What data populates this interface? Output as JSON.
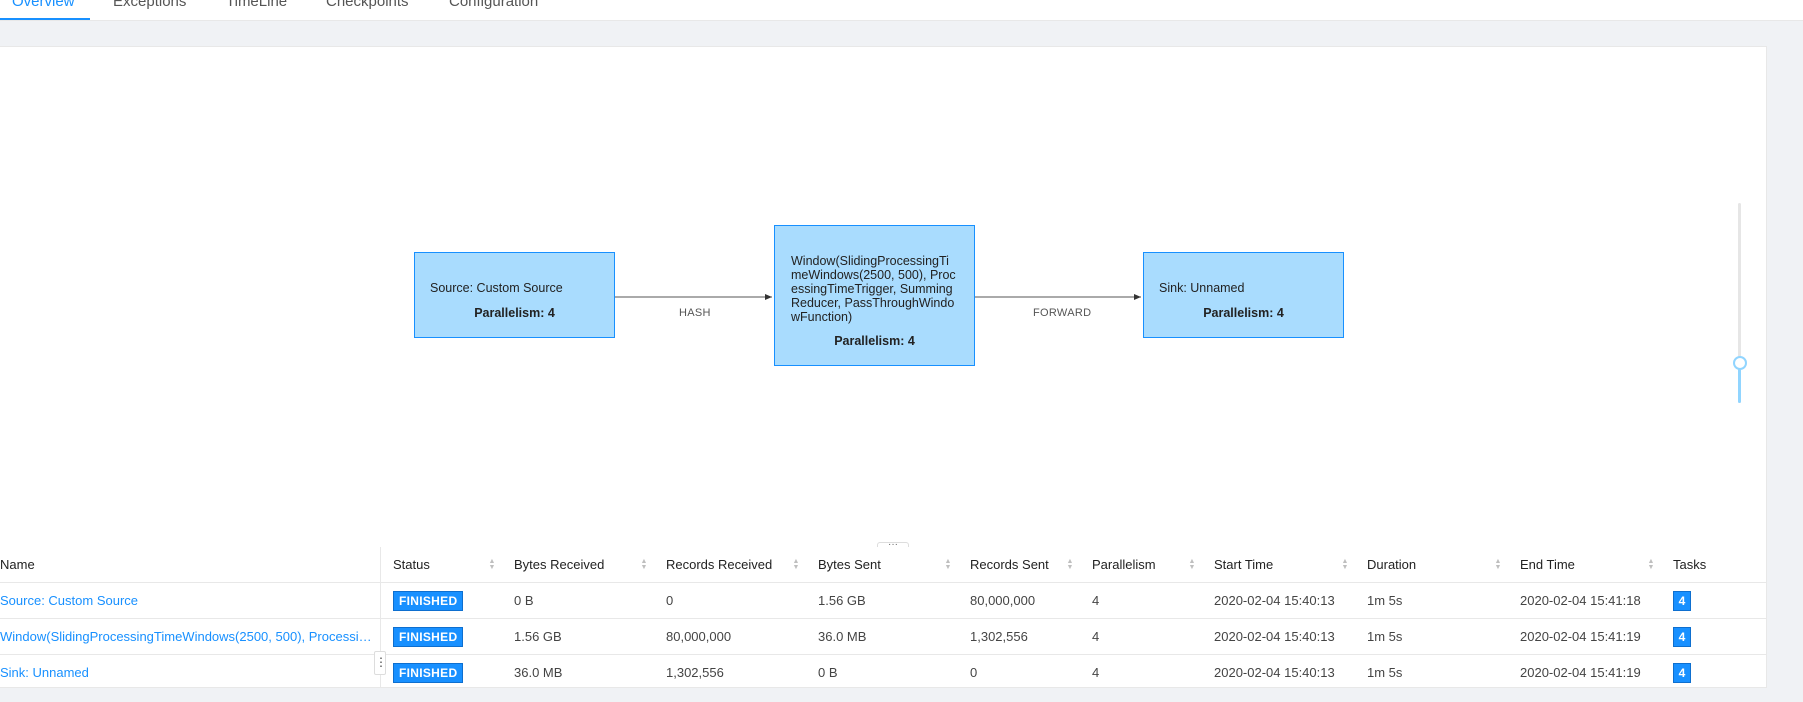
{
  "tabs": [
    {
      "label": "Overview",
      "active": true
    },
    {
      "label": "Exceptions",
      "active": false
    },
    {
      "label": "TimeLine",
      "active": false
    },
    {
      "label": "Checkpoints",
      "active": false
    },
    {
      "label": "Configuration",
      "active": false
    }
  ],
  "graph": {
    "nodes": [
      {
        "name": "Source: Custom Source",
        "parallelism": "Parallelism: 4"
      },
      {
        "name": "Window(SlidingProcessingTimeWindows(2500, 500), ProcessingTimeTrigger, SummingReducer, PassThroughWindowFunction)",
        "parallelism": "Parallelism: 4"
      },
      {
        "name": "Sink: Unnamed",
        "parallelism": "Parallelism: 4"
      }
    ],
    "edges": [
      {
        "label": "HASH"
      },
      {
        "label": "FORWARD"
      }
    ],
    "zoom_level": 0.2
  },
  "table": {
    "columns": [
      "Name",
      "Status",
      "Bytes Received",
      "Records Received",
      "Bytes Sent",
      "Records Sent",
      "Parallelism",
      "Start Time",
      "Duration",
      "End Time",
      "Tasks"
    ],
    "rows": [
      {
        "name": "Source: Custom Source",
        "status": "FINISHED",
        "bytes_received": "0 B",
        "records_received": "0",
        "bytes_sent": "1.56 GB",
        "records_sent": "80,000,000",
        "parallelism": "4",
        "start_time": "2020-02-04 15:40:13",
        "duration": "1m 5s",
        "end_time": "2020-02-04 15:41:18",
        "tasks": "4"
      },
      {
        "name": "Window(SlidingProcessingTimeWindows(2500, 500), Processing...",
        "status": "FINISHED",
        "bytes_received": "1.56 GB",
        "records_received": "80,000,000",
        "bytes_sent": "36.0 MB",
        "records_sent": "1,302,556",
        "parallelism": "4",
        "start_time": "2020-02-04 15:40:13",
        "duration": "1m 5s",
        "end_time": "2020-02-04 15:41:19",
        "tasks": "4"
      },
      {
        "name": "Sink: Unnamed",
        "status": "FINISHED",
        "bytes_received": "36.0 MB",
        "records_received": "1,302,556",
        "bytes_sent": "0 B",
        "records_sent": "0",
        "parallelism": "4",
        "start_time": "2020-02-04 15:40:13",
        "duration": "1m 5s",
        "end_time": "2020-02-04 15:41:19",
        "tasks": "4"
      }
    ]
  },
  "colors": {
    "accent": "#1890ff",
    "node_fill": "#a9dcfe",
    "badge": "#1890ff"
  }
}
